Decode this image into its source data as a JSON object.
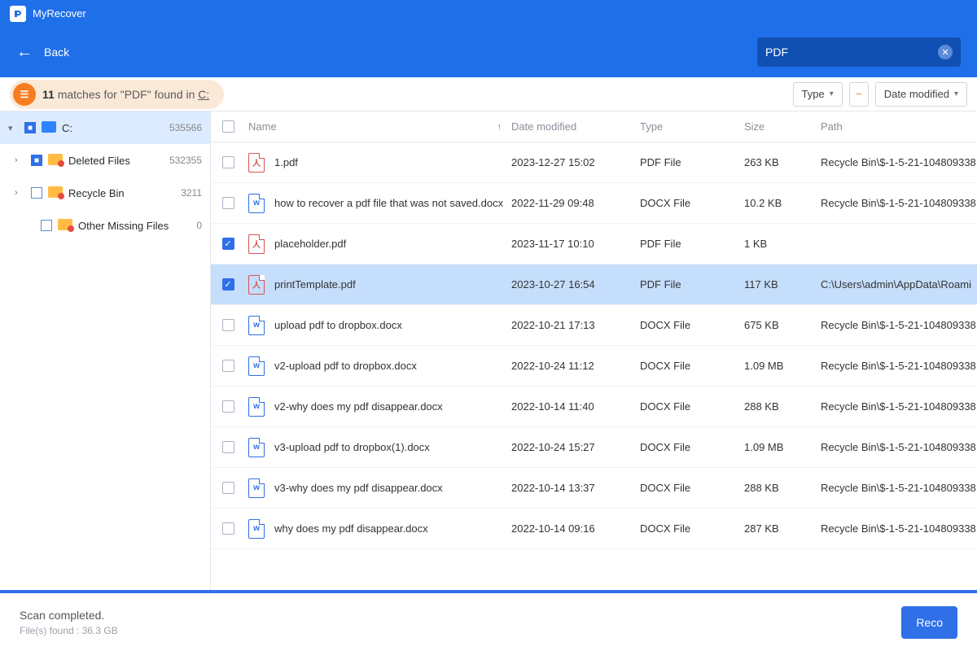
{
  "app": {
    "title": "MyRecover"
  },
  "header": {
    "back_label": "Back",
    "search_value": "PDF"
  },
  "matches": {
    "count": "11",
    "prefix": "matches for",
    "term": "\"PDF\"",
    "middle": "found in",
    "drive": "C:"
  },
  "filters": {
    "type_label": "Type",
    "clear_symbol": "−",
    "date_label": "Date modified"
  },
  "sidebar": [
    {
      "name": "C:",
      "count": "535566",
      "icon": "drive",
      "level": 0,
      "checked": true,
      "expandable": true,
      "expanded": true
    },
    {
      "name": "Deleted Files",
      "count": "532355",
      "icon": "folder",
      "level": 1,
      "checked": true,
      "expandable": true,
      "expanded": false
    },
    {
      "name": "Recycle Bin",
      "count": "3211",
      "icon": "folder",
      "level": 1,
      "checked": false,
      "expandable": true,
      "expanded": false
    },
    {
      "name": "Other Missing Files",
      "count": "0",
      "icon": "folder",
      "level": 2,
      "checked": false,
      "expandable": false,
      "expanded": false
    }
  ],
  "columns": {
    "name": "Name",
    "date": "Date modified",
    "type": "Type",
    "size": "Size",
    "path": "Path"
  },
  "rows": [
    {
      "checked": false,
      "kind": "pdf",
      "name": "1.pdf",
      "date": "2023-12-27 15:02",
      "type": "PDF File",
      "size": "263 KB",
      "path": "Recycle Bin\\$-1-5-21-104809338"
    },
    {
      "checked": false,
      "kind": "docx",
      "name": "how to recover a pdf file that was not saved.docx",
      "date": "2022-11-29 09:48",
      "type": "DOCX File",
      "size": "10.2 KB",
      "path": "Recycle Bin\\$-1-5-21-104809338"
    },
    {
      "checked": true,
      "kind": "pdf",
      "name": "placeholder.pdf",
      "date": "2023-11-17 10:10",
      "type": "PDF File",
      "size": "1 KB",
      "path": ""
    },
    {
      "checked": true,
      "kind": "pdf",
      "name": "printTemplate.pdf",
      "date": "2023-10-27 16:54",
      "type": "PDF File",
      "size": "117 KB",
      "path": "C:\\Users\\admin\\AppData\\Roami",
      "selected": true
    },
    {
      "checked": false,
      "kind": "docx",
      "name": "upload pdf to dropbox.docx",
      "date": "2022-10-21 17:13",
      "type": "DOCX File",
      "size": "675 KB",
      "path": "Recycle Bin\\$-1-5-21-104809338"
    },
    {
      "checked": false,
      "kind": "docx",
      "name": "v2-upload pdf to dropbox.docx",
      "date": "2022-10-24 11:12",
      "type": "DOCX File",
      "size": "1.09 MB",
      "path": "Recycle Bin\\$-1-5-21-104809338"
    },
    {
      "checked": false,
      "kind": "docx",
      "name": "v2-why does my pdf disappear.docx",
      "date": "2022-10-14 11:40",
      "type": "DOCX File",
      "size": "288 KB",
      "path": "Recycle Bin\\$-1-5-21-104809338"
    },
    {
      "checked": false,
      "kind": "docx",
      "name": "v3-upload pdf to dropbox(1).docx",
      "date": "2022-10-24 15:27",
      "type": "DOCX File",
      "size": "1.09 MB",
      "path": "Recycle Bin\\$-1-5-21-104809338"
    },
    {
      "checked": false,
      "kind": "docx",
      "name": "v3-why does my pdf disappear.docx",
      "date": "2022-10-14 13:37",
      "type": "DOCX File",
      "size": "288 KB",
      "path": "Recycle Bin\\$-1-5-21-104809338"
    },
    {
      "checked": false,
      "kind": "docx",
      "name": "why does my pdf disappear.docx",
      "date": "2022-10-14 09:16",
      "type": "DOCX File",
      "size": "287 KB",
      "path": "Recycle Bin\\$-1-5-21-104809338"
    }
  ],
  "footer": {
    "status": "Scan completed.",
    "sub": "File(s) found : 36.3 GB",
    "button": "Reco"
  }
}
